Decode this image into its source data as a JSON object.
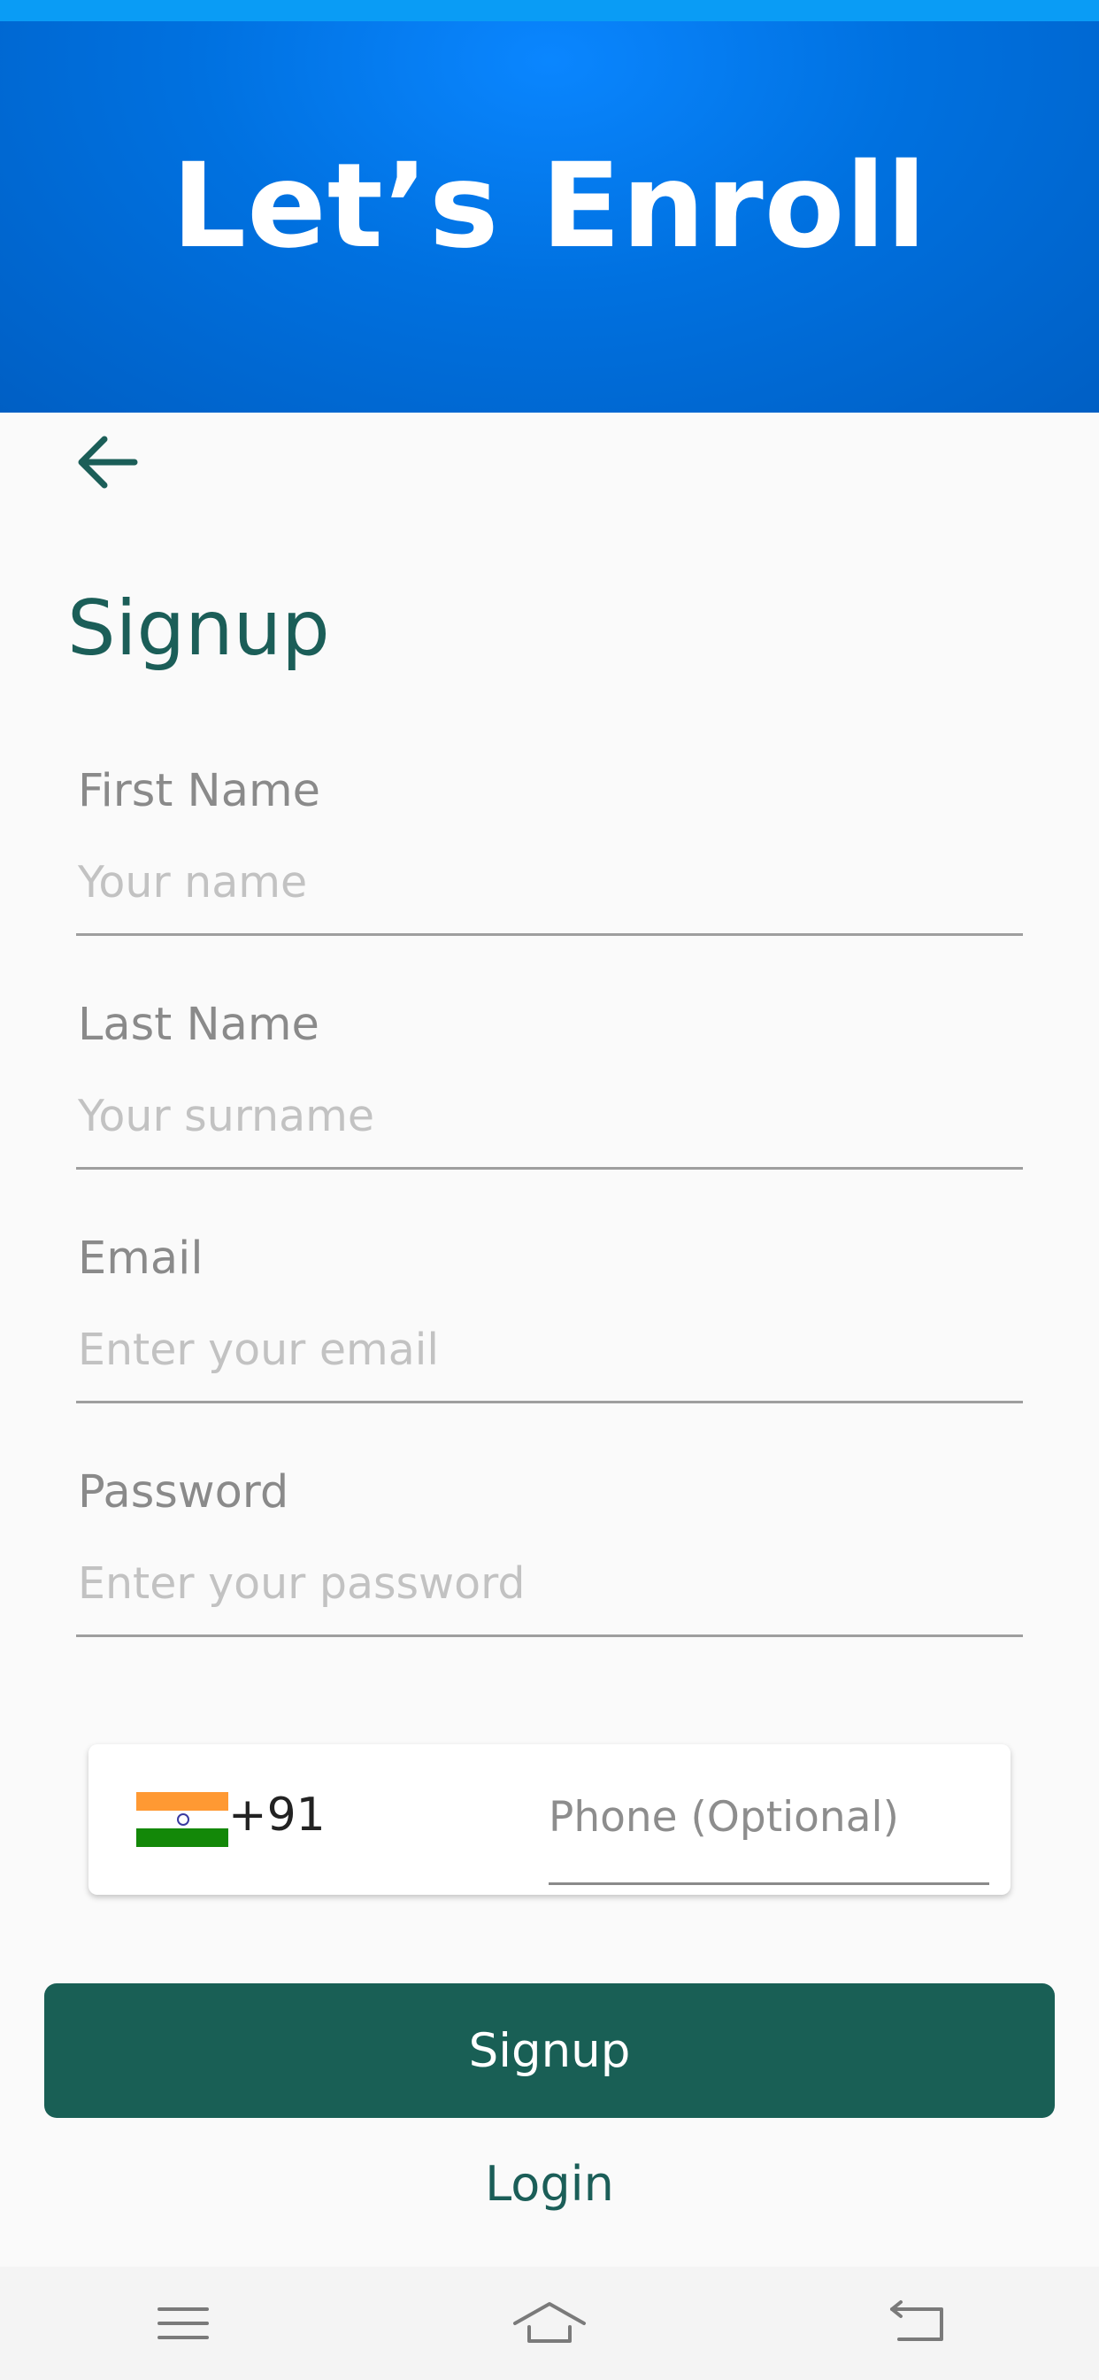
{
  "header": {
    "title": "Let’s Enroll"
  },
  "page": {
    "title": "Signup"
  },
  "form": {
    "first_name": {
      "label": "First Name",
      "placeholder": "Your name"
    },
    "last_name": {
      "label": "Last Name",
      "placeholder": "Your surname"
    },
    "email": {
      "label": "Email",
      "placeholder": "Enter your email"
    },
    "password": {
      "label": "Password",
      "placeholder": "Enter your password"
    },
    "phone": {
      "country_flag": "india-flag-icon",
      "dial_code": "+91",
      "placeholder": "Phone (Optional)"
    }
  },
  "actions": {
    "signup_label": "Signup",
    "login_label": "Login"
  },
  "icons": {
    "back": "arrow-left-icon",
    "nav_menu": "menu-icon",
    "nav_home": "home-icon",
    "nav_back": "back-icon"
  },
  "colors": {
    "header_blue": "#0071e0",
    "accent_green": "#195f55",
    "status_strip": "#0a9cf5"
  }
}
